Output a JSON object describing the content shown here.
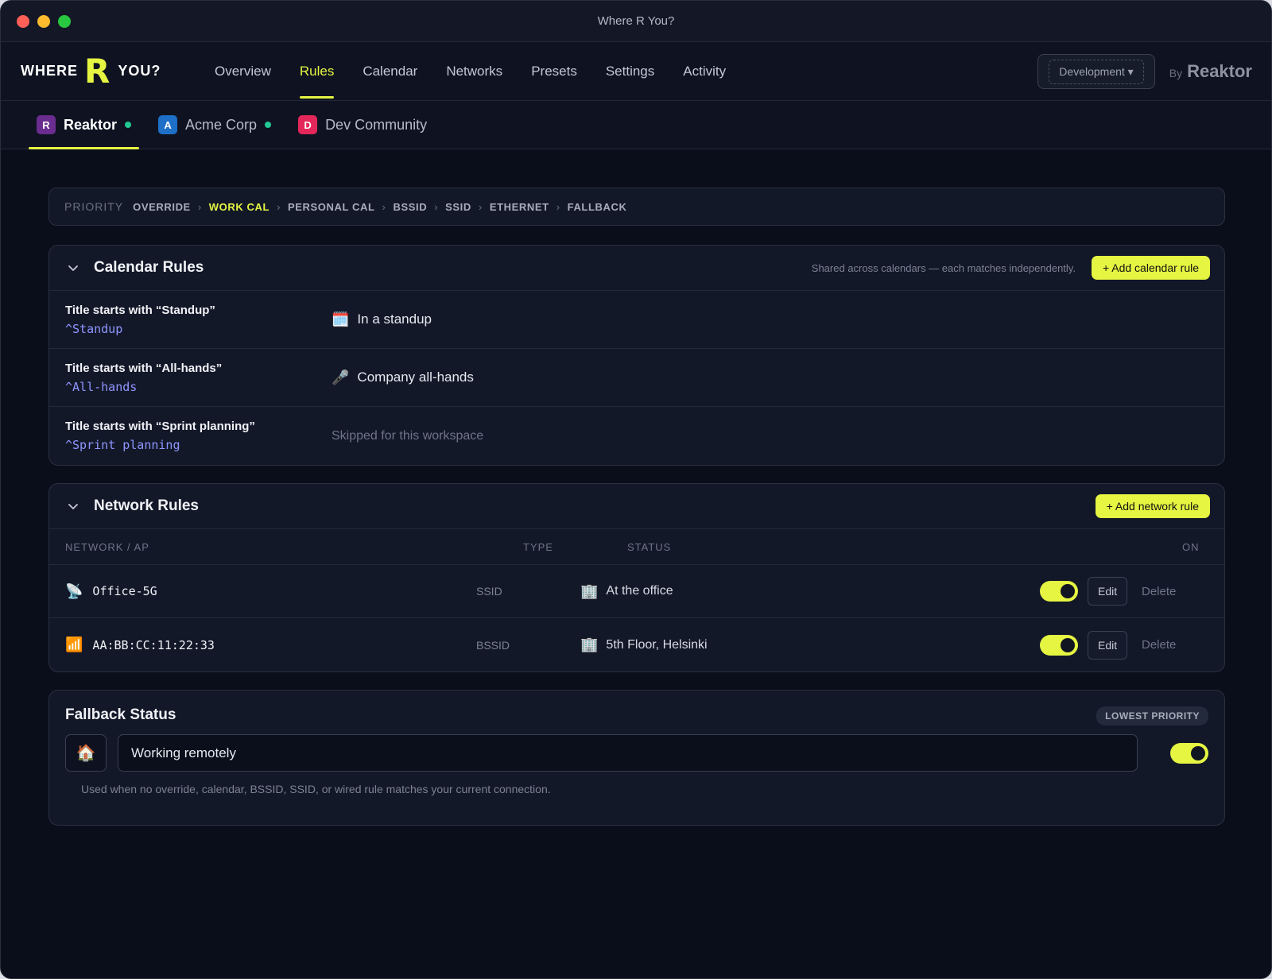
{
  "window": {
    "title": "Where R You?"
  },
  "logo": {
    "left": "WHERE",
    "mark": "R",
    "right": "YOU?"
  },
  "nav": {
    "items": [
      {
        "label": "Overview",
        "active": false
      },
      {
        "label": "Rules",
        "active": true
      },
      {
        "label": "Calendar",
        "active": false
      },
      {
        "label": "Networks",
        "active": false
      },
      {
        "label": "Presets",
        "active": false
      },
      {
        "label": "Settings",
        "active": false
      },
      {
        "label": "Activity",
        "active": false
      }
    ],
    "environment": "Development ▾",
    "by": "By",
    "brand": "Reaktor"
  },
  "workspaces": [
    {
      "initial": "R",
      "name": "Reaktor",
      "color": "#6a2d8f",
      "online": true,
      "active": true
    },
    {
      "initial": "A",
      "name": "Acme Corp",
      "color": "#1e6fc7",
      "online": true,
      "active": false
    },
    {
      "initial": "D",
      "name": "Dev Community",
      "color": "#e4275a",
      "online": false,
      "active": false
    }
  ],
  "priority": {
    "label": "PRIORITY",
    "steps": [
      "OVERRIDE",
      "WORK CAL",
      "PERSONAL CAL",
      "BSSID",
      "SSID",
      "ETHERNET",
      "FALLBACK"
    ],
    "highlighted": "WORK CAL",
    "separator": "›"
  },
  "calendar_rules": {
    "title": "Calendar Rules",
    "hint": "Shared across calendars — each matches independently.",
    "add_label": "+ Add calendar rule",
    "rows": [
      {
        "title": "Title starts with “Standup”",
        "regex": "^Standup",
        "icon": "calendar-icon",
        "emoji": "🗓️",
        "status": "In a standup",
        "muted": false
      },
      {
        "title": "Title starts with “All-hands”",
        "regex": "^All-hands",
        "icon": "microphone-icon",
        "emoji": "🎤",
        "status": "Company all-hands",
        "muted": false
      },
      {
        "title": "Title starts with “Sprint planning”",
        "regex": "^Sprint planning",
        "icon": "",
        "emoji": "",
        "status": "Skipped for this workspace",
        "muted": true
      }
    ]
  },
  "network_rules": {
    "title": "Network Rules",
    "add_label": "+ Add network rule",
    "columns": {
      "network": "NETWORK / AP",
      "type": "TYPE",
      "status": "STATUS",
      "on": "ON"
    },
    "rows": [
      {
        "icon": "satellite-antenna-icon",
        "emoji": "📡",
        "network": "Office-5G",
        "type": "SSID",
        "status_icon": "office-building-icon",
        "status_emoji": "🏢",
        "status": "At the office",
        "on": true,
        "edit": "Edit",
        "delete": "Delete"
      },
      {
        "icon": "signal-bars-icon",
        "emoji": "📶",
        "network": "AA:BB:CC:11:22:33",
        "type": "BSSID",
        "status_icon": "office-building-icon",
        "status_emoji": "🏢",
        "status": "5th Floor, Helsinki",
        "on": true,
        "edit": "Edit",
        "delete": "Delete"
      }
    ]
  },
  "fallback": {
    "title": "Fallback Status",
    "badge": "LOWEST PRIORITY",
    "emoji": "🏠",
    "icon": "house-icon",
    "value": "Working remotely",
    "enabled": true,
    "note": "Used when no override, calendar, BSSID, SSID, or wired rule matches your current connection."
  },
  "colors": {
    "accent": "#e5f542",
    "online_dot": "#22c994",
    "regex": "#8f96ff",
    "background": "#0a0e1a"
  }
}
